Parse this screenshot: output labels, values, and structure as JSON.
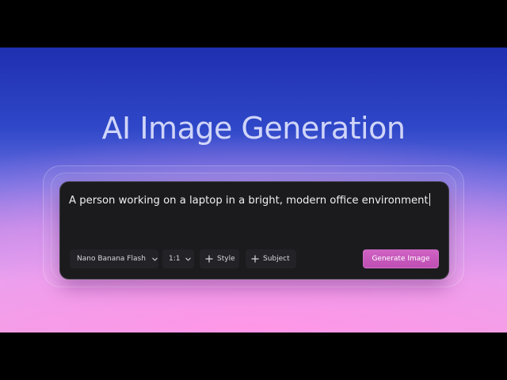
{
  "headline": "AI Image Generation",
  "prompt": {
    "value": "A person working on a laptop in a bright, modern office environment"
  },
  "toolbar": {
    "model": {
      "label": "Nano Banana Flash",
      "icon": "chevron-down-icon"
    },
    "aspect_ratio": {
      "label": "1:1",
      "icon": "chevron-down-icon"
    },
    "style": {
      "label": "Style",
      "icon": "plus-icon"
    },
    "subject": {
      "label": "Subject",
      "icon": "plus-icon"
    },
    "generate": {
      "label": "Generate Image"
    }
  },
  "colors": {
    "accent": "#c658bb",
    "card_background": "#1b1b1e",
    "chip_background": "#232327",
    "title_text": "#e6e8ff"
  }
}
